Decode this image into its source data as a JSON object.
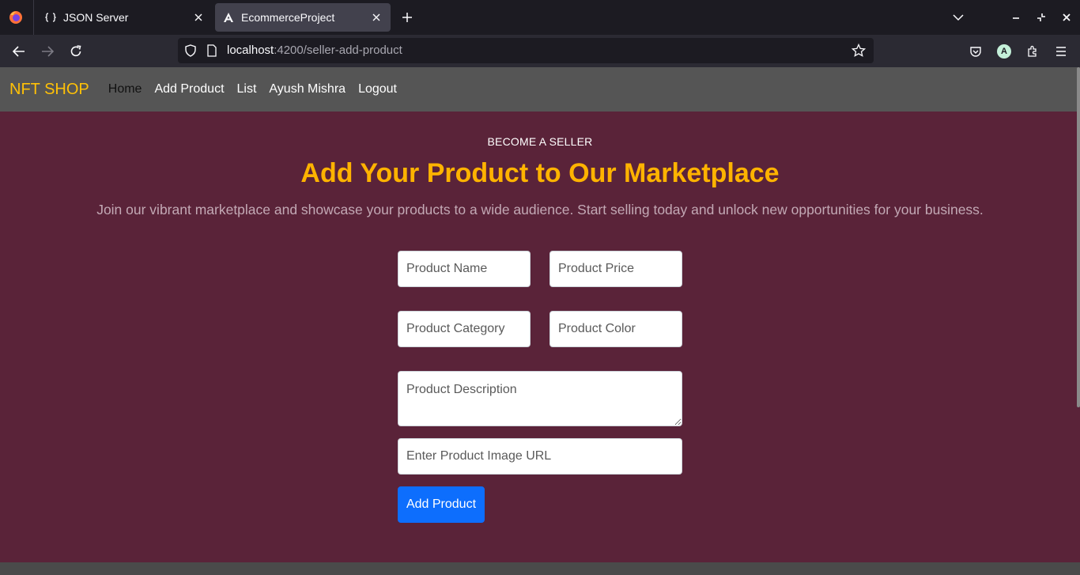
{
  "browser": {
    "tabs": [
      {
        "title": "JSON Server",
        "active": false
      },
      {
        "title": "EcommerceProject",
        "active": true
      }
    ],
    "url": {
      "host": "localhost",
      "rest": ":4200/seller-add-product"
    },
    "profile_initial": "A"
  },
  "navbar": {
    "brand": "NFT SHOP",
    "links": [
      "Home",
      "Add Product",
      "List",
      "Ayush Mishra",
      "Logout"
    ]
  },
  "hero": {
    "overline": "BECOME A SELLER",
    "title": "Add Your Product to Our Marketplace",
    "subtitle": "Join our vibrant marketplace and showcase your products to a wide audience. Start selling today and unlock new opportunities for your business."
  },
  "form": {
    "name_placeholder": "Product Name",
    "price_placeholder": "Product Price",
    "category_placeholder": "Product Category",
    "color_placeholder": "Product Color",
    "description_placeholder": "Product Description",
    "image_placeholder": "Enter Product Image URL",
    "submit_label": "Add Product"
  },
  "colors": {
    "brand": "#ffc107",
    "hero_bg": "#5a2339",
    "headline": "#ffb300",
    "button": "#0d6efd"
  },
  "icons": [
    "firefox-logo-icon",
    "json-server-favicon-icon",
    "angular-favicon-icon",
    "close-icon",
    "plus-icon",
    "chevron-down-icon",
    "minimize-icon",
    "restore-icon",
    "back-arrow-icon",
    "forward-arrow-icon",
    "reload-icon",
    "shield-icon",
    "page-icon",
    "star-icon",
    "pocket-icon",
    "extensions-icon",
    "menu-icon"
  ]
}
